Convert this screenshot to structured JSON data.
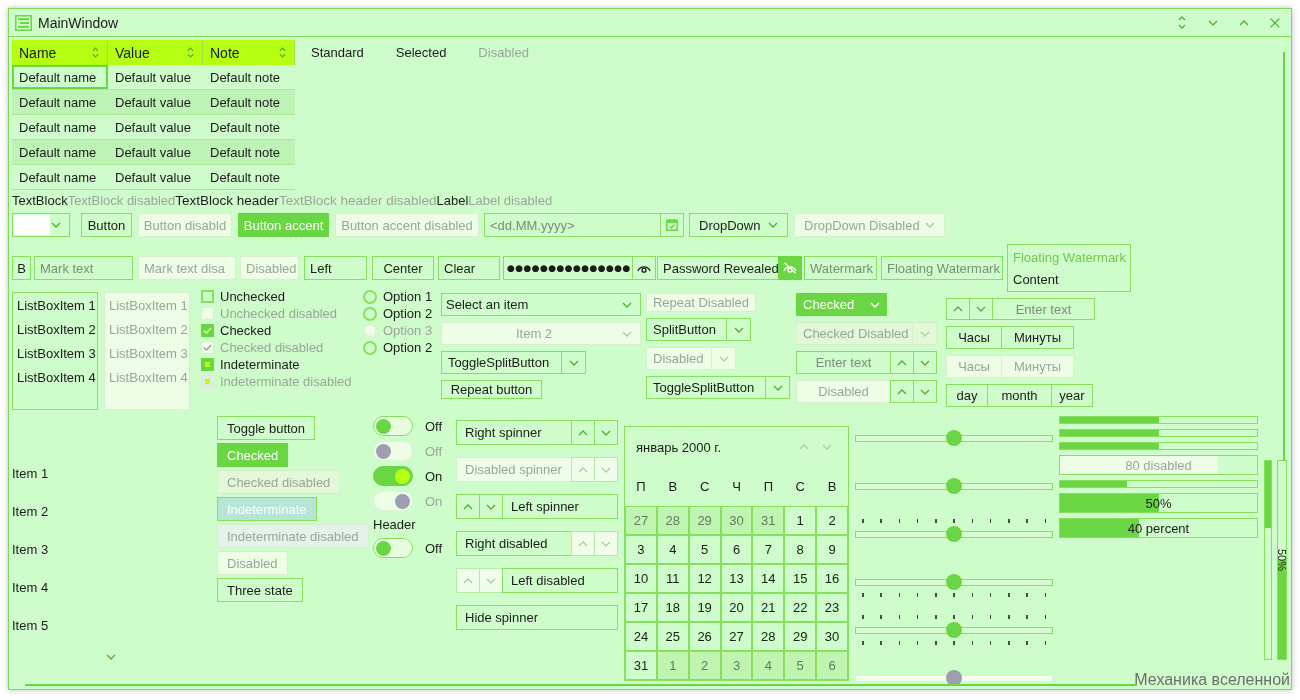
{
  "window": {
    "title": "MainWindow"
  },
  "data_grid": {
    "columns": [
      "Name",
      "Value",
      "Note"
    ],
    "rows": [
      {
        "cells": [
          "Default name",
          "Default value",
          "Default note"
        ],
        "selected": true
      },
      {
        "cells": [
          "Default name",
          "Default value",
          "Default note"
        ],
        "selected": false
      },
      {
        "cells": [
          "Default name",
          "Default value",
          "Default note"
        ],
        "selected": false
      },
      {
        "cells": [
          "Default name",
          "Default value",
          "Default note"
        ],
        "selected": false
      },
      {
        "cells": [
          "Default name",
          "Default value",
          "Default note"
        ],
        "selected": false
      }
    ]
  },
  "tabs": [
    {
      "label": "Standard",
      "disabled": false
    },
    {
      "label": "Selected",
      "disabled": false
    },
    {
      "label": "Disabled",
      "disabled": true
    }
  ],
  "text_blocks": [
    {
      "text": "TextBlock",
      "header": false,
      "disabled": false
    },
    {
      "text": "TextBlock disabled",
      "header": false,
      "disabled": true
    },
    {
      "text": "TextBlock header",
      "header": true,
      "disabled": false
    },
    {
      "text": "TextBlock header disabled",
      "header": true,
      "disabled": true
    },
    {
      "text": "Label",
      "header": false,
      "disabled": false
    },
    {
      "text": "Label disabled",
      "header": false,
      "disabled": true
    }
  ],
  "button_row": [
    {
      "kind": "combo",
      "disabled": false
    },
    {
      "kind": "button",
      "label": "Button",
      "disabled": false
    },
    {
      "kind": "button",
      "label": "Button disabld",
      "disabled": true
    },
    {
      "kind": "accent",
      "label": "Button accent",
      "disabled": false
    },
    {
      "kind": "accent",
      "label": "Button accent disabled",
      "disabled": true
    },
    {
      "kind": "date",
      "placeholder": "<dd.MM.yyyy>",
      "disabled": false
    },
    {
      "kind": "dropdown",
      "label": "DropDown",
      "disabled": false
    },
    {
      "kind": "dropdown",
      "label": "DropDown Disabled",
      "disabled": true
    }
  ],
  "input_row": [
    {
      "kind": "toggle",
      "label": "B"
    },
    {
      "kind": "text",
      "placeholder": "Mark text",
      "centered": false,
      "disabled": false
    },
    {
      "kind": "text",
      "placeholder": "Mark text disa",
      "centered": false,
      "disabled": true
    },
    {
      "kind": "text",
      "value": "Disabled",
      "centered": false,
      "disabled": true
    },
    {
      "kind": "text",
      "value": "Left",
      "centered": false,
      "disabled": false
    },
    {
      "kind": "text",
      "value": "Center",
      "centered": true,
      "disabled": false
    },
    {
      "kind": "text",
      "value": "Clear",
      "centered": false,
      "disabled": false
    },
    {
      "kind": "password",
      "value": "●●●●●●●●●●●●●●●",
      "revealed": false
    },
    {
      "kind": "password",
      "value": "Password Revealed",
      "revealed": true
    },
    {
      "kind": "text",
      "placeholder": "Watermark",
      "centered": false,
      "disabled": false
    },
    {
      "kind": "text",
      "placeholder": "Floating Watermark",
      "centered": false,
      "disabled": false
    },
    {
      "kind": "floating",
      "label": "Floating Watermark",
      "value": "Content"
    }
  ],
  "list_boxes": [
    {
      "disabled": false,
      "items": [
        "ListBoxItem 1",
        "ListBoxItem 2",
        "ListBoxItem 3",
        "ListBoxItem 4"
      ]
    },
    {
      "disabled": true,
      "items": [
        "ListBoxItem 1",
        "ListBoxItem 2",
        "ListBoxItem 3",
        "ListBoxItem 4"
      ]
    }
  ],
  "checkboxes": [
    {
      "label": "Unchecked",
      "checked": false,
      "indeterminate": false,
      "disabled": false
    },
    {
      "label": "Unchecked disabled",
      "checked": false,
      "indeterminate": false,
      "disabled": true
    },
    {
      "label": "Checked",
      "checked": true,
      "indeterminate": false,
      "disabled": false
    },
    {
      "label": "Checked disabled",
      "checked": true,
      "indeterminate": false,
      "disabled": true
    },
    {
      "label": "Indeterminate",
      "checked": false,
      "indeterminate": true,
      "disabled": false
    },
    {
      "label": "Indeterminate disabled",
      "checked": false,
      "indeterminate": true,
      "disabled": true
    }
  ],
  "radio_buttons": [
    {
      "label": "Option 1",
      "selected": false,
      "disabled": false
    },
    {
      "label": "Option 2",
      "selected": false,
      "disabled": false
    },
    {
      "label": "Option 3",
      "selected": false,
      "disabled": true
    },
    {
      "label": "Option 2",
      "selected": false,
      "disabled": false
    }
  ],
  "combo_column": [
    {
      "kind": "combo",
      "value": "Select an item",
      "centered": false,
      "disabled": false
    },
    {
      "kind": "combo",
      "value": "Item 2",
      "centered": true,
      "disabled": true
    },
    {
      "kind": "split",
      "label": "ToggleSplitButton",
      "checked": false,
      "disabled": false
    },
    {
      "kind": "button",
      "label": "Repeat button",
      "disabled": false
    }
  ],
  "split_column": [
    {
      "kind": "button",
      "label": "Repeat Disabled",
      "disabled": true
    },
    {
      "kind": "split",
      "label": "SplitButton",
      "checked": false,
      "disabled": false
    },
    {
      "kind": "split",
      "label": "Disabled",
      "checked": false,
      "disabled": true
    },
    {
      "kind": "split",
      "label": "ToggleSplitButton",
      "checked": false,
      "disabled": false
    }
  ],
  "numeric_column": [
    {
      "kind": "split",
      "label": "Checked",
      "checked": true,
      "disabled": false
    },
    {
      "kind": "split",
      "label": "Checked Disabled",
      "checked": true,
      "disabled": true
    },
    {
      "kind": "numeric",
      "placeholder": "Enter text",
      "disabled": false
    },
    {
      "kind": "numeric",
      "placeholder": "Disabled",
      "disabled": true
    }
  ],
  "time_column": [
    {
      "kind": "spinner",
      "placeholder": "Enter text",
      "disabled": false
    },
    {
      "kind": "segments",
      "parts": [
        "Часы",
        "Минуты"
      ],
      "disabled": false
    },
    {
      "kind": "segments",
      "parts": [
        "Часы",
        "Минуты"
      ],
      "disabled": true
    },
    {
      "kind": "segments",
      "parts": [
        "day",
        "month",
        "year"
      ],
      "disabled": false
    }
  ],
  "items_list": [
    "Item 1",
    "Item 2",
    "Item 3",
    "Item 4",
    "Item 5"
  ],
  "toggle_buttons": [
    {
      "label": "Toggle button",
      "checked": false,
      "indeterminate": false,
      "disabled": false
    },
    {
      "label": "Checked",
      "checked": true,
      "indeterminate": false,
      "disabled": false
    },
    {
      "label": "Checked disabled",
      "checked": true,
      "indeterminate": false,
      "disabled": true
    },
    {
      "label": "Indeterminate",
      "checked": false,
      "indeterminate": true,
      "disabled": false
    },
    {
      "label": "Indeterminate disabled",
      "checked": false,
      "indeterminate": true,
      "disabled": true
    },
    {
      "label": "Disabled",
      "checked": false,
      "indeterminate": false,
      "disabled": true
    },
    {
      "label": "Three state",
      "checked": false,
      "indeterminate": false,
      "disabled": false
    }
  ],
  "switches": [
    {
      "label": "Off",
      "on": false,
      "disabled": false
    },
    {
      "label": "Off",
      "on": false,
      "disabled": true
    },
    {
      "label": "On",
      "on": true,
      "disabled": false
    },
    {
      "label": "On",
      "on": true,
      "disabled": true
    },
    {
      "header": "Header",
      "label": "Off",
      "on": false,
      "disabled": false
    }
  ],
  "spinners": [
    {
      "kind": "right",
      "text": "Right spinner",
      "disabled": false,
      "buttons_disabled": false
    },
    {
      "kind": "right",
      "text": "Disabled spinner",
      "disabled": true,
      "buttons_disabled": true
    },
    {
      "kind": "left",
      "text": "Left spinner",
      "disabled": false,
      "buttons_disabled": false
    },
    {
      "kind": "right",
      "text": "Right disabled",
      "disabled": false,
      "buttons_disabled": true
    },
    {
      "kind": "left",
      "text": "Left disabled",
      "disabled": false,
      "buttons_disabled": true
    },
    {
      "kind": "hidden",
      "text": "Hide spinner",
      "disabled": false
    }
  ],
  "calendar": {
    "title": "январь 2000 г.",
    "weekdays": [
      "П",
      "В",
      "С",
      "Ч",
      "П",
      "С",
      "В"
    ],
    "days": [
      {
        "label": "27",
        "outside": true
      },
      {
        "label": "28",
        "outside": true
      },
      {
        "label": "29",
        "outside": true
      },
      {
        "label": "30",
        "outside": true
      },
      {
        "label": "31",
        "outside": true
      },
      {
        "label": "1",
        "outside": false
      },
      {
        "label": "2",
        "outside": false
      },
      {
        "label": "3",
        "outside": false
      },
      {
        "label": "4",
        "outside": false
      },
      {
        "label": "5",
        "outside": false
      },
      {
        "label": "6",
        "outside": false
      },
      {
        "label": "7",
        "outside": false
      },
      {
        "label": "8",
        "outside": false
      },
      {
        "label": "9",
        "outside": false
      },
      {
        "label": "10",
        "outside": false
      },
      {
        "label": "11",
        "outside": false
      },
      {
        "label": "12",
        "outside": false
      },
      {
        "label": "13",
        "outside": false
      },
      {
        "label": "14",
        "outside": false
      },
      {
        "label": "15",
        "outside": false
      },
      {
        "label": "16",
        "outside": false
      },
      {
        "label": "17",
        "outside": false
      },
      {
        "label": "18",
        "outside": false
      },
      {
        "label": "19",
        "outside": false
      },
      {
        "label": "20",
        "outside": false
      },
      {
        "label": "21",
        "outside": false
      },
      {
        "label": "22",
        "outside": false
      },
      {
        "label": "23",
        "outside": false
      },
      {
        "label": "24",
        "outside": false
      },
      {
        "label": "25",
        "outside": false
      },
      {
        "label": "26",
        "outside": false
      },
      {
        "label": "27",
        "outside": false
      },
      {
        "label": "28",
        "outside": false
      },
      {
        "label": "29",
        "outside": false
      },
      {
        "label": "30",
        "outside": false
      },
      {
        "label": "31",
        "outside": false
      },
      {
        "label": "1",
        "outside": true
      },
      {
        "label": "2",
        "outside": true
      },
      {
        "label": "3",
        "outside": true
      },
      {
        "label": "4",
        "outside": true
      },
      {
        "label": "5",
        "outside": true
      },
      {
        "label": "6",
        "outside": true
      }
    ]
  },
  "sliders": [
    {
      "level": 0.5,
      "ticks_above": false,
      "ticks_below": false,
      "disabled": false
    },
    {
      "level": 0.5,
      "ticks_above": false,
      "ticks_below": false,
      "disabled": false
    },
    {
      "level": 0.5,
      "ticks_above": true,
      "ticks_below": false,
      "disabled": false
    },
    {
      "level": 0.5,
      "ticks_above": false,
      "ticks_below": true,
      "disabled": false
    },
    {
      "level": 0.5,
      "ticks_above": true,
      "ticks_below": true,
      "disabled": false
    },
    {
      "level": 0.5,
      "ticks_above": false,
      "ticks_below": false,
      "disabled": true
    }
  ],
  "progress_bars": [
    {
      "level": 0.5,
      "disabled": false
    },
    {
      "level": 0.5,
      "disabled": false
    },
    {
      "level": 0.5,
      "disabled": false
    },
    {
      "level": 0.8,
      "label": "80 disabled",
      "disabled": true
    },
    {
      "level": 0.34,
      "disabled": false
    },
    {
      "level": 0.5,
      "label": "50%",
      "disabled": false
    },
    {
      "level": 0.4,
      "label": "40 percent",
      "disabled": false
    }
  ],
  "vertical_bars": [
    {
      "level": 0.34,
      "reversed": true
    },
    {
      "level": 0.5,
      "reversed": false,
      "label": "50%"
    }
  ],
  "footer_text": "Механика вселенной"
}
